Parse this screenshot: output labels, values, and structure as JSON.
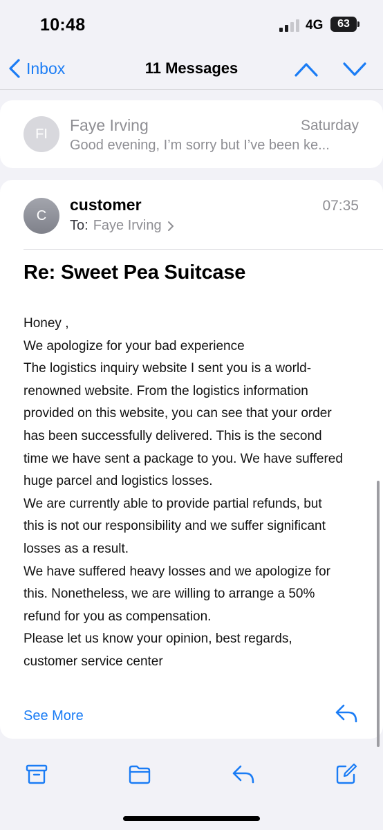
{
  "status": {
    "time": "10:48",
    "network": "4G",
    "battery": "63"
  },
  "nav": {
    "back_label": "Inbox",
    "title": "11 Messages"
  },
  "thread": [
    {
      "initials": "FI",
      "sender": "Faye Irving",
      "date": "Saturday",
      "preview": "Good evening, I’m sorry but I’ve been ke..."
    }
  ],
  "message": {
    "initials": "C",
    "sender": "customer",
    "time": "07:35",
    "to_label": "To:",
    "to_name": "Faye Irving",
    "subject": "Re: Sweet Pea Suitcase",
    "body_lines": [
      "Honey ,",
      "We apologize for your bad experience",
      "The logistics inquiry website I sent you is a world-",
      "renowned website. From the logistics information",
      "provided on this website, you can see that your order",
      "has been successfully delivered. This is the second",
      "time we have sent a package to you. We have suffered",
      "huge parcel and logistics losses.",
      "We are currently able to provide partial refunds, but",
      "this is not our responsibility and we suffer significant",
      "losses as a result.",
      "We have suffered heavy losses and we apologize for",
      "this. Nonetheless, we are willing to arrange a 50%",
      "refund for you as compensation.",
      "Please let us know your opinion, best regards,",
      "customer service center"
    ],
    "see_more": "See More"
  },
  "icons": {
    "back": "chevron-left-icon",
    "prev": "chevron-up-icon",
    "next": "chevron-down-icon",
    "reply": "reply-icon",
    "archive": "archive-icon",
    "folder": "folder-icon",
    "compose": "compose-icon"
  },
  "colors": {
    "accent": "#1a7cf5",
    "background": "#f2f2f7",
    "secondary_text": "#8e8e93"
  }
}
